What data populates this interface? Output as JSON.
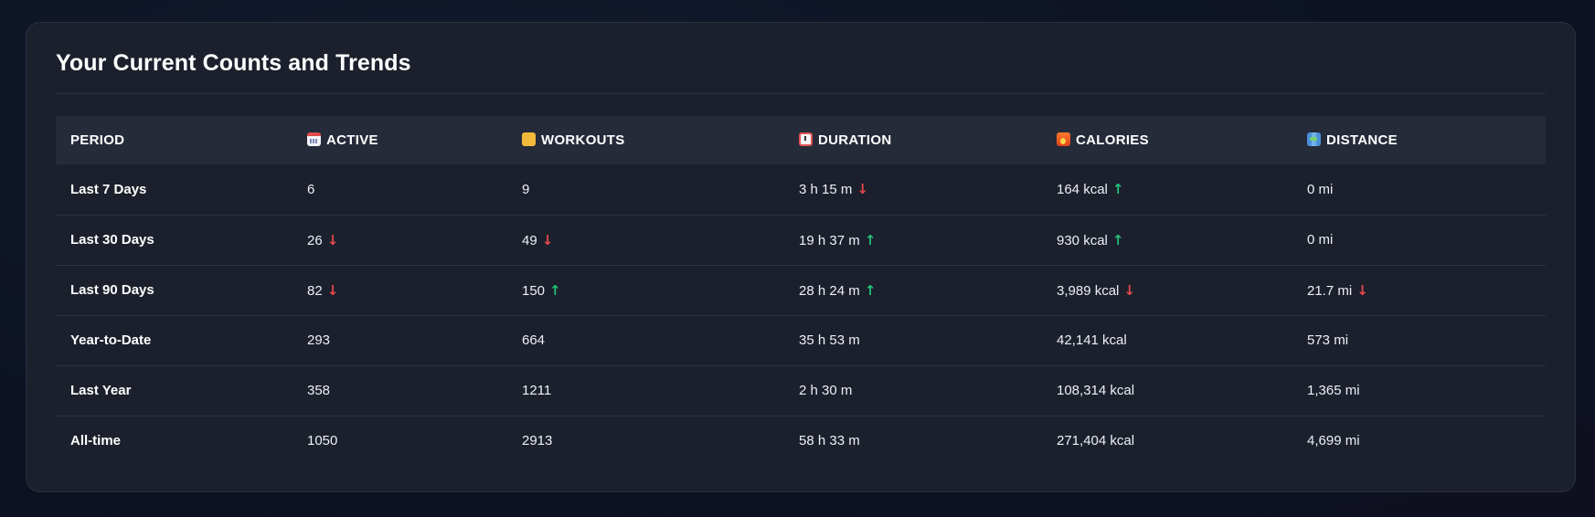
{
  "card": {
    "title": "Your Current Counts and Trends"
  },
  "colors": {
    "trend_up": "#25c07a",
    "trend_down": "#e8484c"
  },
  "columns": [
    {
      "key": "period",
      "label": "Period",
      "icon": ""
    },
    {
      "key": "active",
      "label": "Active",
      "icon": "calendar-icon"
    },
    {
      "key": "workouts",
      "label": "Workouts",
      "icon": "flexed-biceps-icon"
    },
    {
      "key": "duration",
      "label": "Duration",
      "icon": "alarm-clock-icon"
    },
    {
      "key": "calories",
      "label": "Calories",
      "icon": "fire-icon"
    },
    {
      "key": "distance",
      "label": "Distance",
      "icon": "map-icon"
    }
  ],
  "rows": [
    {
      "period": "Last 7 Days",
      "active": {
        "value": "6",
        "trend": ""
      },
      "workouts": {
        "value": "9",
        "trend": ""
      },
      "duration": {
        "value": "3 h 15 m",
        "trend": "down"
      },
      "calories": {
        "value": "164 kcal",
        "trend": "up"
      },
      "distance": {
        "value": "0 mi",
        "trend": ""
      }
    },
    {
      "period": "Last 30 Days",
      "active": {
        "value": "26",
        "trend": "down"
      },
      "workouts": {
        "value": "49",
        "trend": "down"
      },
      "duration": {
        "value": "19 h 37 m",
        "trend": "up"
      },
      "calories": {
        "value": "930 kcal",
        "trend": "up"
      },
      "distance": {
        "value": "0 mi",
        "trend": ""
      }
    },
    {
      "period": "Last 90 Days",
      "active": {
        "value": "82",
        "trend": "down"
      },
      "workouts": {
        "value": "150",
        "trend": "up"
      },
      "duration": {
        "value": "28 h 24 m",
        "trend": "up"
      },
      "calories": {
        "value": "3,989 kcal",
        "trend": "down"
      },
      "distance": {
        "value": "21.7 mi",
        "trend": "down"
      }
    },
    {
      "period": "Year-to-Date",
      "active": {
        "value": "293",
        "trend": ""
      },
      "workouts": {
        "value": "664",
        "trend": ""
      },
      "duration": {
        "value": "35 h 53 m",
        "trend": ""
      },
      "calories": {
        "value": "42,141 kcal",
        "trend": ""
      },
      "distance": {
        "value": "573 mi",
        "trend": ""
      }
    },
    {
      "period": "Last Year",
      "active": {
        "value": "358",
        "trend": ""
      },
      "workouts": {
        "value": "1211",
        "trend": ""
      },
      "duration": {
        "value": "2 h 30 m",
        "trend": ""
      },
      "calories": {
        "value": "108,314 kcal",
        "trend": ""
      },
      "distance": {
        "value": "1,365 mi",
        "trend": ""
      }
    },
    {
      "period": "All-time",
      "active": {
        "value": "1050",
        "trend": ""
      },
      "workouts": {
        "value": "2913",
        "trend": ""
      },
      "duration": {
        "value": "58 h 33 m",
        "trend": ""
      },
      "calories": {
        "value": "271,404 kcal",
        "trend": ""
      },
      "distance": {
        "value": "4,699 mi",
        "trend": ""
      }
    }
  ]
}
